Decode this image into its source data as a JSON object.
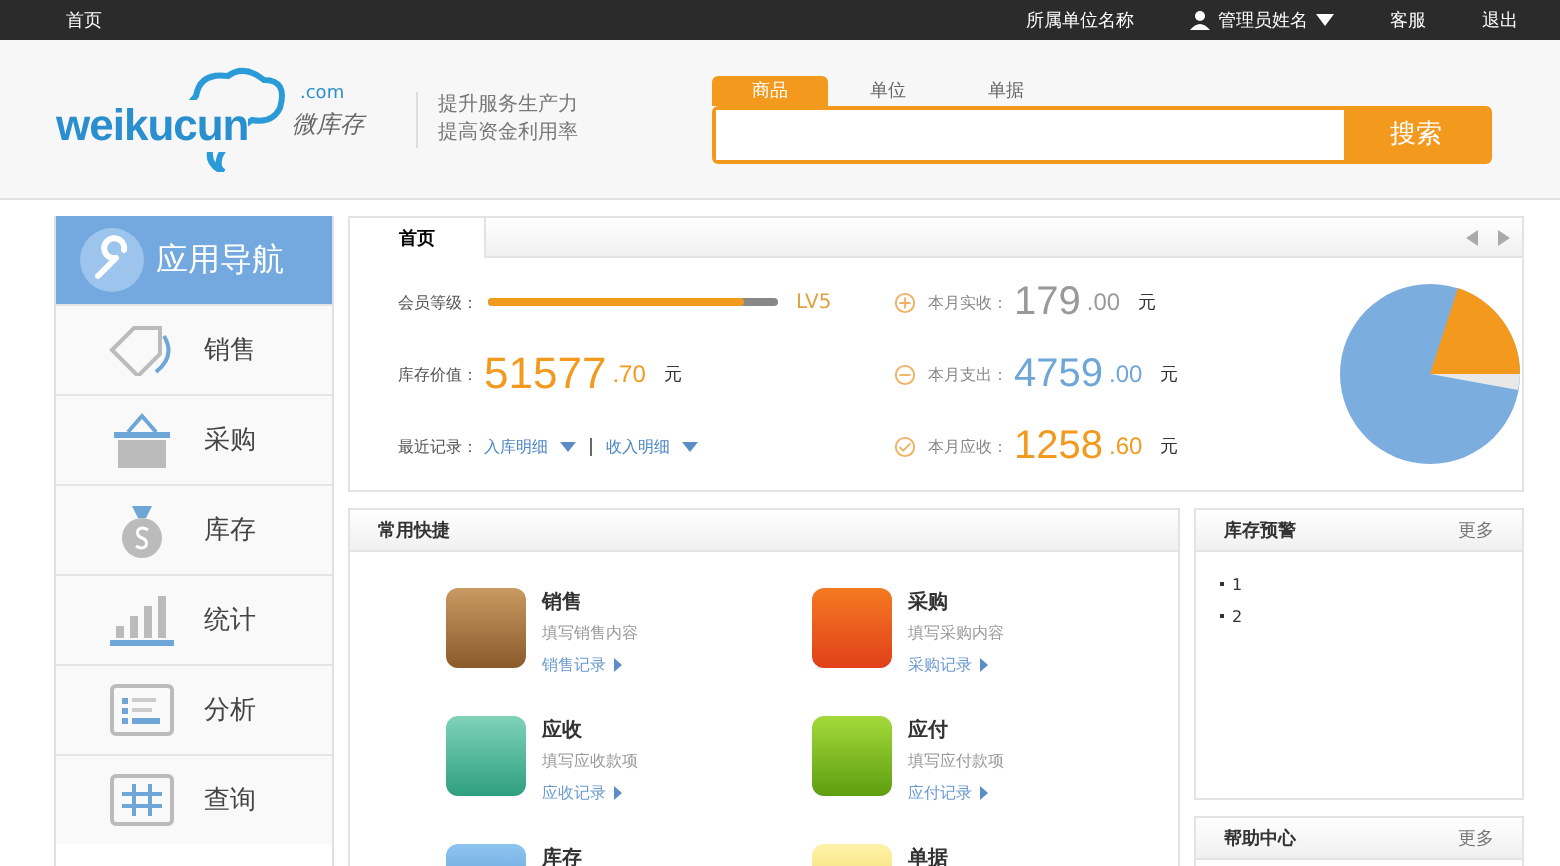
{
  "top_bar": {
    "home": "首页",
    "unit": "所属单位名称",
    "user": "管理员姓名",
    "service": "客服",
    "logout": "退出"
  },
  "logo": {
    "name": "weikucun",
    "domain": ".com",
    "cn": "微库存"
  },
  "slogan": [
    "提升服务生产力",
    "提高资金利用率"
  ],
  "search": {
    "tabs": [
      {
        "label": "商品",
        "selected": true
      },
      {
        "label": "单位",
        "selected": false
      },
      {
        "label": "单据",
        "selected": false
      }
    ],
    "button": "搜索"
  },
  "sidebar": {
    "title": "应用导航",
    "items": [
      {
        "label": "销售",
        "kind": "tag"
      },
      {
        "label": "采购",
        "kind": "basket"
      },
      {
        "label": "库存",
        "kind": "moneybag"
      },
      {
        "label": "统计",
        "kind": "bars"
      },
      {
        "label": "分析",
        "kind": "list"
      },
      {
        "label": "查询",
        "kind": "grid"
      }
    ]
  },
  "overview": {
    "tab": "首页",
    "member": {
      "label": "会员等级：",
      "level": 0.88,
      "grade": "LV5"
    },
    "stock": {
      "label": "库存价值：",
      "integer": "51577",
      "decimal": ".70",
      "unit": "元"
    },
    "recent": {
      "label": "最近记录：",
      "links": [
        "入库明细",
        "收入明细"
      ]
    },
    "month": [
      {
        "kind": "plus",
        "label": "本月实收：",
        "integer": "179",
        "decimal": ".00",
        "unit": "元",
        "color": "#999999"
      },
      {
        "kind": "minus",
        "label": "本月支出：",
        "integer": "4759",
        "decimal": ".00",
        "unit": "元",
        "color": "#6ea6d8"
      },
      {
        "kind": "check",
        "label": "本月应收：",
        "integer": "1258",
        "decimal": ".60",
        "unit": "元",
        "color": "#f39a1e"
      }
    ]
  },
  "shortcuts": {
    "title": "常用快捷",
    "items": [
      {
        "kind": "sale",
        "title": "销售",
        "desc": "填写销售内容",
        "link": "销售记录"
      },
      {
        "kind": "cart",
        "title": "采购",
        "desc": "填写采购内容",
        "link": "采购记录"
      },
      {
        "kind": "receive",
        "title": "应收",
        "desc": "填写应收款项",
        "link": "应收记录"
      },
      {
        "kind": "pay",
        "title": "应付",
        "desc": "填写应付款项",
        "link": "应付记录"
      },
      {
        "kind": "stock",
        "title": "库存"
      },
      {
        "kind": "doc",
        "title": "单据"
      }
    ]
  },
  "stock_alert": {
    "title": "库存预警",
    "more": "更多",
    "items": [
      "1",
      "2"
    ]
  },
  "help": {
    "title": "帮助中心",
    "more": "更多"
  }
}
